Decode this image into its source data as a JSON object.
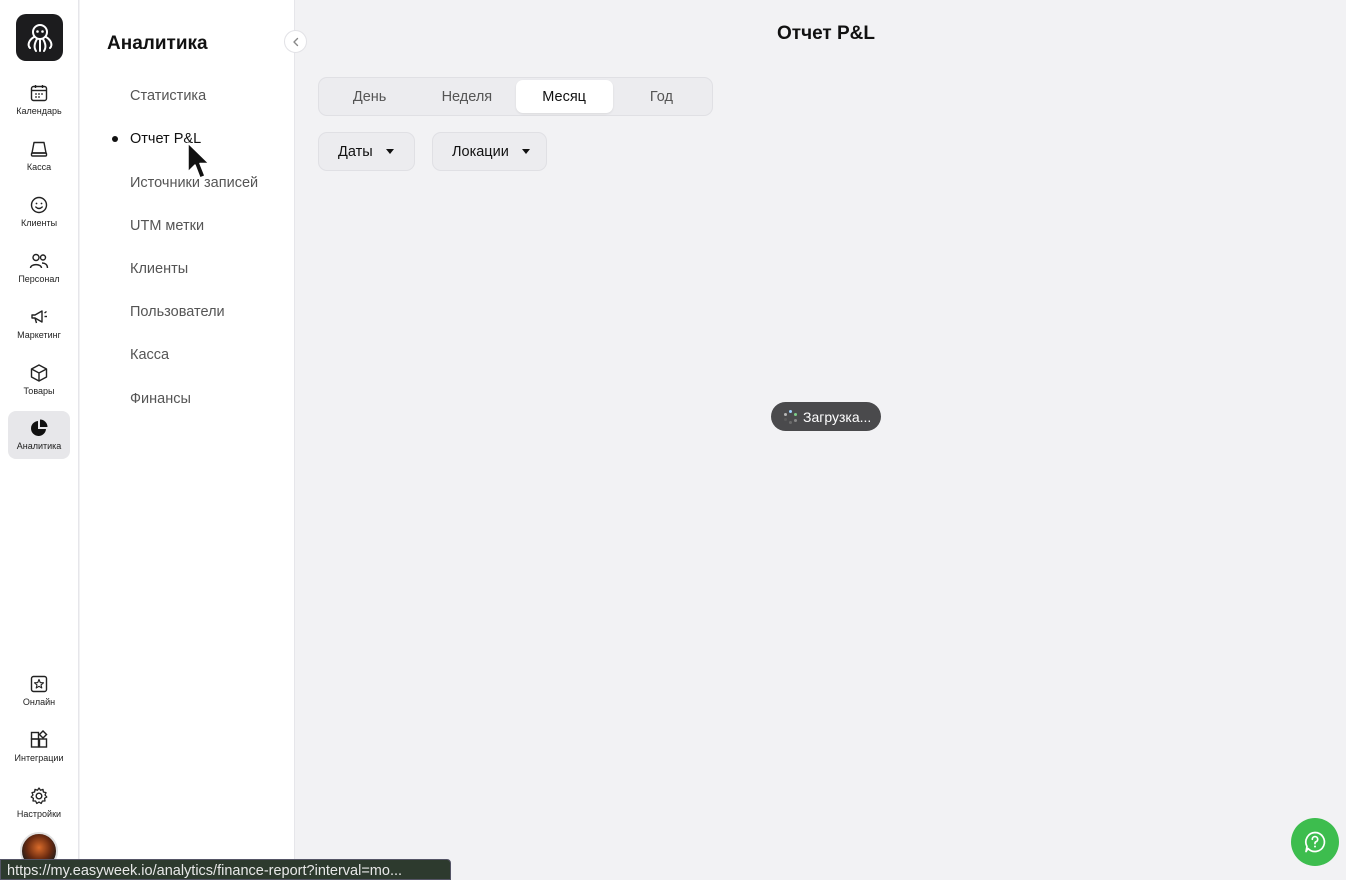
{
  "rail": {
    "items": [
      {
        "label": "Календарь",
        "icon": "calendar-icon"
      },
      {
        "label": "Касса",
        "icon": "cash-register-icon"
      },
      {
        "label": "Клиенты",
        "icon": "smiley-icon"
      },
      {
        "label": "Персонал",
        "icon": "staff-icon"
      },
      {
        "label": "Маркетинг",
        "icon": "megaphone-icon"
      },
      {
        "label": "Товары",
        "icon": "box-icon"
      },
      {
        "label": "Аналитика",
        "icon": "pie-chart-icon",
        "active": true
      }
    ],
    "bottom_items": [
      {
        "label": "Онлайн",
        "icon": "star-icon"
      },
      {
        "label": "Интеграции",
        "icon": "integrations-icon"
      },
      {
        "label": "Настройки",
        "icon": "gear-icon"
      }
    ]
  },
  "sidebar": {
    "title": "Аналитика",
    "items": [
      {
        "label": "Статистика"
      },
      {
        "label": "Отчет P&L",
        "active": true
      },
      {
        "label": "Источники записей"
      },
      {
        "label": "UTM метки"
      },
      {
        "label": "Клиенты"
      },
      {
        "label": "Пользователи"
      },
      {
        "label": "Касса"
      },
      {
        "label": "Финансы"
      }
    ]
  },
  "main": {
    "title": "Отчет P&L",
    "periods": [
      "День",
      "Неделя",
      "Месяц",
      "Год"
    ],
    "selected_period": "Месяц",
    "filters": {
      "dates": "Даты",
      "locations": "Локации"
    },
    "loading_text": "Загрузка..."
  },
  "status_bar": {
    "url": "https://my.easyweek.io/analytics/finance-report?interval=mo..."
  },
  "colors": {
    "accent_green": "#3dbd4e",
    "loading_bg": "#4a4a4c",
    "rail_bg": "#ffffff",
    "main_bg": "#f2f2f4"
  }
}
